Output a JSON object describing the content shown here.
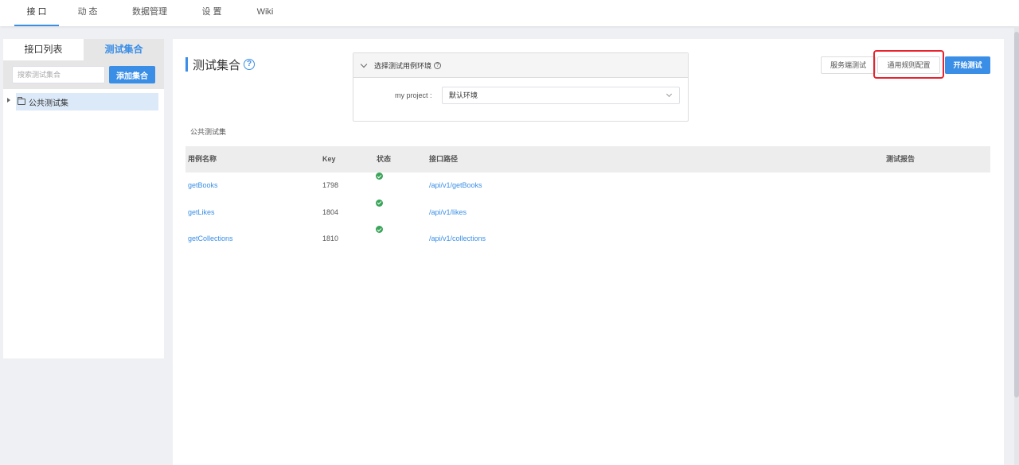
{
  "nav": {
    "tabs": [
      "接 口",
      "动 态",
      "数据管理",
      "设 置",
      "Wiki"
    ]
  },
  "left": {
    "tab_api_list": "接口列表",
    "tab_test_collection": "测试集合",
    "search_placeholder": "搜索测试集合",
    "add_collection_label": "添加集合",
    "tree_item": "公共测试集"
  },
  "main": {
    "title": "测试集合",
    "env": {
      "heading": "选择测试用例环境",
      "project_label": "my project :",
      "selected_env": "默认环境"
    },
    "buttons": {
      "server_test": "服务端测试",
      "rules_config": "通用规则配置",
      "start_test": "开始测试"
    },
    "collection_name": "公共测试集",
    "table": {
      "headers": [
        "用例名称",
        "Key",
        "状态",
        "接口路径",
        "测试报告"
      ],
      "rows": [
        {
          "name": "getBooks",
          "key": "1798",
          "status": "ok",
          "path": "/api/v1/getBooks",
          "report": ""
        },
        {
          "name": "getLikes",
          "key": "1804",
          "status": "ok",
          "path": "/api/v1/likes",
          "report": ""
        },
        {
          "name": "getCollections",
          "key": "1810",
          "status": "ok",
          "path": "/api/v1/collections",
          "report": ""
        }
      ]
    }
  },
  "colors": {
    "accent": "#3a8ee6",
    "success": "#3aa55a",
    "highlight": "#e8232e"
  }
}
